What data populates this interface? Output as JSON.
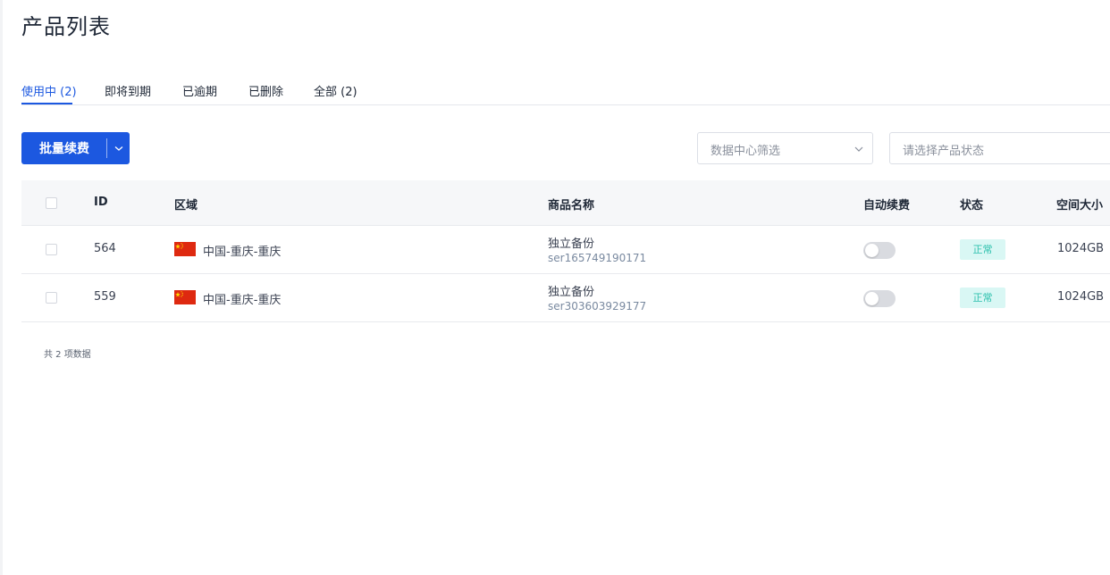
{
  "page": {
    "title": "产品列表"
  },
  "tabs": [
    {
      "label": "使用中 (2)",
      "active": true
    },
    {
      "label": "即将到期"
    },
    {
      "label": "已逾期"
    },
    {
      "label": "已删除"
    },
    {
      "label": "全部 (2)"
    }
  ],
  "toolbar": {
    "renew_button_label": "批量续费",
    "datacenter_filter_placeholder": "数据中心筛选",
    "status_filter_placeholder": "请选择产品状态"
  },
  "table": {
    "columns": [
      "ID",
      "区域",
      "商品名称",
      "自动续费",
      "状态",
      "空间大小"
    ],
    "rows": [
      {
        "id": "564",
        "region": "中国-重庆-重庆",
        "product_name": "独立备份",
        "product_id": "ser165749190171",
        "auto_renew": false,
        "status": "正常",
        "size": "1024GB"
      },
      {
        "id": "559",
        "region": "中国-重庆-重庆",
        "product_name": "独立备份",
        "product_id": "ser303603929177",
        "auto_renew": false,
        "status": "正常",
        "size": "1024GB"
      }
    ]
  },
  "footer": {
    "total_text": "共 2 项数据"
  },
  "colors": {
    "accent": "#1c58e0",
    "status_bg": "#d9f7f4",
    "status_text": "#2cc0ad",
    "flag_red": "#de2910",
    "flag_yellow": "#ffde00"
  },
  "icons": {
    "flag": "china-flag-icon",
    "dropdown": "chevron-down-icon"
  }
}
